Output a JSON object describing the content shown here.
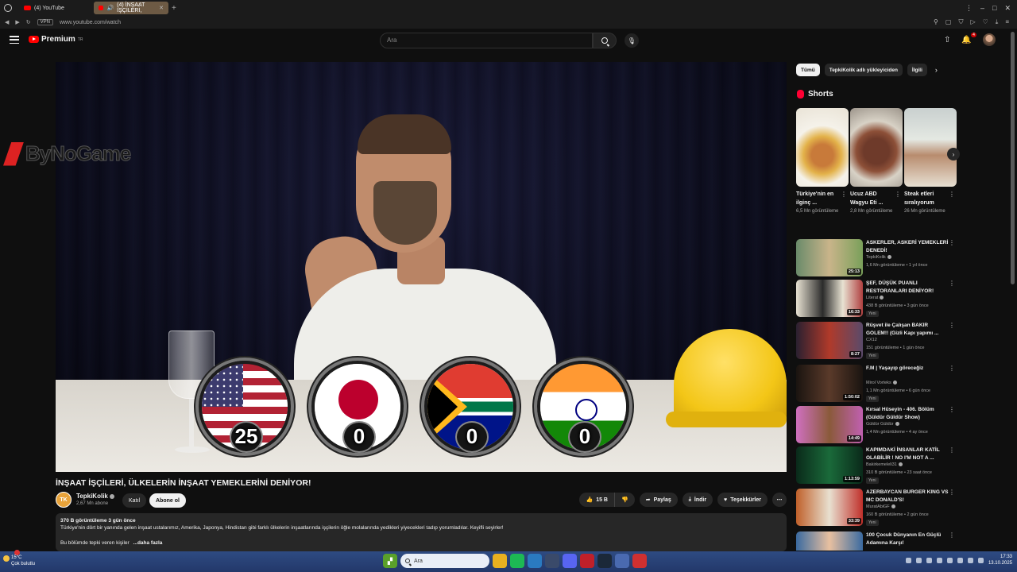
{
  "browser": {
    "tabs": [
      {
        "label": "(4) YouTube"
      },
      {
        "label": "(4) İNŞAAT İŞÇİLERİ,"
      }
    ],
    "new_tab": "+",
    "vpn": "VPN",
    "url": "www.youtube.com/watch"
  },
  "header": {
    "logo_text": "Premium",
    "logo_region": "TR",
    "search_placeholder": "Ara",
    "notification_count": "4"
  },
  "video": {
    "watermark": "ByNoGame",
    "scores": [
      "25",
      "0",
      "0",
      "0"
    ],
    "flags": [
      "usa-flag",
      "japan-flag",
      "south-africa-flag",
      "india-flag"
    ],
    "title": "İNŞAAT İŞÇİLERİ, ÜLKELERİN İNŞAAT YEMEKLERİNİ DENİYOR!",
    "channel": {
      "initials": "TK",
      "name": "TepkiKolik",
      "subs": "2,67 Mn abone"
    },
    "join_label": "Katıl",
    "subscribe_label": "Abone ol",
    "actions": {
      "likes": "15 B",
      "share": "Paylaş",
      "download": "İndir",
      "thanks": "Teşekkürler"
    },
    "description": {
      "meta": "370 B görüntüleme  3 gün önce",
      "line1": "Türkiye'nin dört bir yanında gelen inşaat ustalarımız, Amerika, Japonya, Hindistan gibi farklı ülkelerin inşaatlarında işçilerin öğle molalarında yedikleri yiyecekleri tadıp yorumladılar. Keyifli seyirler!",
      "line2": "Bu bölümde tepki veren kişiler",
      "more": "...daha fazla"
    }
  },
  "sidebar": {
    "chips": [
      "Tümü",
      "TepkiKolik adlı yükleyiciden",
      "İlgili"
    ],
    "shorts_title": "Shorts",
    "shorts": [
      {
        "title": "Türkiye'nin en ilginç ...",
        "views": "6,5 Mn görüntüleme"
      },
      {
        "title": "Ucuz ABD Wagyu Eti ...",
        "views": "2,8 Mn görüntüleme"
      },
      {
        "title": "Steak etleri sıralıyorum",
        "views": "26 Mn görüntüleme"
      }
    ],
    "recommendations": [
      {
        "title": "ASKERLER, ASKERİ YEMEKLERİ DENEDİ!",
        "channel": "TepkiKolik",
        "views": "1,6 Mn görüntüleme • 1 yıl önce",
        "duration": "25:13",
        "new": ""
      },
      {
        "title": "ŞEF, DÜŞÜK PUANLI RESTORANLARI DENİYOR!",
        "channel": "Literat",
        "views": "438 B görüntüleme • 3 gün önce",
        "duration": "16:33",
        "new": "Yeni"
      },
      {
        "title": "Rüşvet ile Çalışan BAKIR GOLEM!! (Gizli Kapı yapımı ...",
        "channel": "CX12",
        "views": "151 görüntüleme • 1 gün önce",
        "duration": "8:27",
        "new": "Yeni"
      },
      {
        "title": "F.M | Yaşayıp göreceğiz",
        "channel": "Mirol Vorteks",
        "views": "1,1 Mn görüntüleme • 6 gün önce",
        "duration": "1:50:02",
        "new": "Yeni"
      },
      {
        "title": "Kırsal Hüseyin - 406. Bölüm (Güldür Güldür Show)",
        "channel": "Güldür Güldür",
        "views": "1,4 Mn görüntüleme • 4 ay önce",
        "duration": "14:49",
        "new": ""
      },
      {
        "title": "KAPIMDAKİ İNSANLAR KATİL OLABİLİR ! NO I'M NOT A ...",
        "channel": "Bakirkemeleli31",
        "views": "310 B görüntüleme • 23 saat önce",
        "duration": "1:13:59",
        "new": "Yeni"
      },
      {
        "title": "AZERBAYCAN BURGER KING VS MC DONALD'S!",
        "channel": "MuratAbiGF",
        "views": "160 B görüntüleme • 2 gün önce",
        "duration": "33:39",
        "new": "Yeni"
      },
      {
        "title": "100 Çocuk Dünyanın En Güçlü Adamına Karşı!",
        "channel": "",
        "views": "",
        "duration": "",
        "new": ""
      }
    ]
  },
  "taskbar": {
    "weather_temp": "15°C",
    "weather_desc": "Çok bulutlu",
    "search_placeholder": "Ara",
    "time": "17:33",
    "date": "13.10.2025"
  },
  "colors": {
    "background": "#0f0f0f",
    "youtube_red": "#ff0000",
    "taskbar": "#2e4b82"
  }
}
